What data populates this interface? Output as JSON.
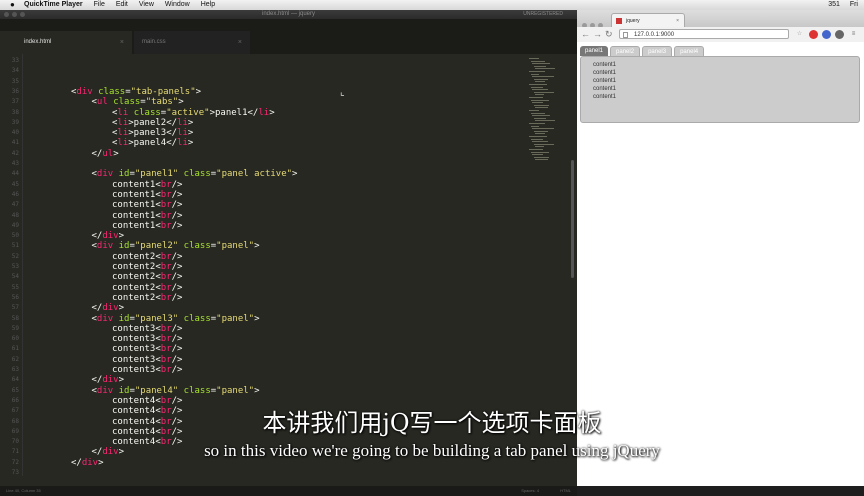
{
  "menubar": {
    "app_name": "QuickTime Player",
    "items": [
      "File",
      "Edit",
      "View",
      "Window",
      "Help"
    ],
    "status": [
      "351",
      "Fri"
    ]
  },
  "editor": {
    "window_title": "index.html — jquery",
    "title_right": "UNREGISTERED",
    "tabs": [
      {
        "label": "index.html",
        "active": true
      },
      {
        "label": "main.css",
        "active": false
      }
    ],
    "line_numbers": [
      "33",
      "34",
      "35",
      "36",
      "37",
      "38",
      "39",
      "40",
      "41",
      "42",
      "43",
      "44",
      "45",
      "46",
      "47",
      "48",
      "49",
      "50",
      "51",
      "52",
      "53",
      "54",
      "55",
      "56",
      "57",
      "58",
      "59",
      "60",
      "61",
      "62",
      "63",
      "64",
      "65",
      "66",
      "67",
      "68",
      "69",
      "70",
      "71",
      "72",
      "73"
    ],
    "code_lines": [
      {
        "indent": 0,
        "parts": []
      },
      {
        "indent": 0,
        "parts": []
      },
      {
        "indent": 0,
        "parts": []
      },
      {
        "indent": 2,
        "parts": [
          [
            "p",
            "<"
          ],
          [
            "t",
            "div"
          ],
          [
            "p",
            " "
          ],
          [
            "a",
            "class"
          ],
          [
            "p",
            "="
          ],
          [
            "s",
            "\"tab-panels\""
          ],
          [
            "p",
            ">"
          ]
        ]
      },
      {
        "indent": 3,
        "parts": [
          [
            "p",
            "<"
          ],
          [
            "t",
            "ul"
          ],
          [
            "p",
            " "
          ],
          [
            "a",
            "class"
          ],
          [
            "p",
            "="
          ],
          [
            "s",
            "\"tabs\""
          ],
          [
            "p",
            ">"
          ]
        ]
      },
      {
        "indent": 4,
        "parts": [
          [
            "p",
            "<"
          ],
          [
            "t",
            "li"
          ],
          [
            "p",
            " "
          ],
          [
            "a",
            "class"
          ],
          [
            "p",
            "="
          ],
          [
            "s",
            "\"active\""
          ],
          [
            "p",
            ">panel1</"
          ],
          [
            "t",
            "li"
          ],
          [
            "p",
            ">"
          ]
        ]
      },
      {
        "indent": 4,
        "parts": [
          [
            "p",
            "<"
          ],
          [
            "t",
            "li"
          ],
          [
            "p",
            ">panel2</"
          ],
          [
            "t",
            "li"
          ],
          [
            "p",
            ">"
          ]
        ]
      },
      {
        "indent": 4,
        "parts": [
          [
            "p",
            "<"
          ],
          [
            "t",
            "li"
          ],
          [
            "p",
            ">panel3</"
          ],
          [
            "t",
            "li"
          ],
          [
            "p",
            ">"
          ]
        ]
      },
      {
        "indent": 4,
        "parts": [
          [
            "p",
            "<"
          ],
          [
            "t",
            "li"
          ],
          [
            "p",
            ">panel4</"
          ],
          [
            "t",
            "li"
          ],
          [
            "p",
            ">"
          ]
        ]
      },
      {
        "indent": 3,
        "parts": [
          [
            "p",
            "</"
          ],
          [
            "t",
            "ul"
          ],
          [
            "p",
            ">"
          ]
        ]
      },
      {
        "indent": 0,
        "parts": []
      },
      {
        "indent": 3,
        "parts": [
          [
            "p",
            "<"
          ],
          [
            "t",
            "div"
          ],
          [
            "p",
            " "
          ],
          [
            "a",
            "id"
          ],
          [
            "p",
            "="
          ],
          [
            "s",
            "\"panel1\""
          ],
          [
            "p",
            " "
          ],
          [
            "a",
            "class"
          ],
          [
            "p",
            "="
          ],
          [
            "s",
            "\"panel active\""
          ],
          [
            "p",
            ">"
          ]
        ]
      },
      {
        "indent": 4,
        "parts": [
          [
            "p",
            "content1<"
          ],
          [
            "t",
            "br"
          ],
          [
            "p",
            "/>"
          ]
        ]
      },
      {
        "indent": 4,
        "parts": [
          [
            "p",
            "content1<"
          ],
          [
            "t",
            "br"
          ],
          [
            "p",
            "/>"
          ]
        ]
      },
      {
        "indent": 4,
        "parts": [
          [
            "p",
            "content1<"
          ],
          [
            "t",
            "br"
          ],
          [
            "p",
            "/>"
          ]
        ]
      },
      {
        "indent": 4,
        "parts": [
          [
            "p",
            "content1<"
          ],
          [
            "t",
            "br"
          ],
          [
            "p",
            "/>"
          ]
        ]
      },
      {
        "indent": 4,
        "parts": [
          [
            "p",
            "content1<"
          ],
          [
            "t",
            "br"
          ],
          [
            "p",
            "/>"
          ]
        ]
      },
      {
        "indent": 3,
        "parts": [
          [
            "p",
            "</"
          ],
          [
            "t",
            "div"
          ],
          [
            "p",
            ">"
          ]
        ]
      },
      {
        "indent": 3,
        "parts": [
          [
            "p",
            "<"
          ],
          [
            "t",
            "div"
          ],
          [
            "p",
            " "
          ],
          [
            "a",
            "id"
          ],
          [
            "p",
            "="
          ],
          [
            "s",
            "\"panel2\""
          ],
          [
            "p",
            " "
          ],
          [
            "a",
            "class"
          ],
          [
            "p",
            "="
          ],
          [
            "s",
            "\"panel\""
          ],
          [
            "p",
            ">"
          ]
        ]
      },
      {
        "indent": 4,
        "parts": [
          [
            "p",
            "content2<"
          ],
          [
            "t",
            "br"
          ],
          [
            "p",
            "/>"
          ]
        ]
      },
      {
        "indent": 4,
        "parts": [
          [
            "p",
            "content2<"
          ],
          [
            "t",
            "br"
          ],
          [
            "p",
            "/>"
          ]
        ]
      },
      {
        "indent": 4,
        "parts": [
          [
            "p",
            "content2<"
          ],
          [
            "t",
            "br"
          ],
          [
            "p",
            "/>"
          ]
        ]
      },
      {
        "indent": 4,
        "parts": [
          [
            "p",
            "content2<"
          ],
          [
            "t",
            "br"
          ],
          [
            "p",
            "/>"
          ]
        ]
      },
      {
        "indent": 4,
        "parts": [
          [
            "p",
            "content2<"
          ],
          [
            "t",
            "br"
          ],
          [
            "p",
            "/>"
          ]
        ]
      },
      {
        "indent": 3,
        "parts": [
          [
            "p",
            "</"
          ],
          [
            "t",
            "div"
          ],
          [
            "p",
            ">"
          ]
        ]
      },
      {
        "indent": 3,
        "parts": [
          [
            "p",
            "<"
          ],
          [
            "t",
            "div"
          ],
          [
            "p",
            " "
          ],
          [
            "a",
            "id"
          ],
          [
            "p",
            "="
          ],
          [
            "s",
            "\"panel3\""
          ],
          [
            "p",
            " "
          ],
          [
            "a",
            "class"
          ],
          [
            "p",
            "="
          ],
          [
            "s",
            "\"panel\""
          ],
          [
            "p",
            ">"
          ]
        ]
      },
      {
        "indent": 4,
        "parts": [
          [
            "p",
            "content3<"
          ],
          [
            "t",
            "br"
          ],
          [
            "p",
            "/>"
          ]
        ]
      },
      {
        "indent": 4,
        "parts": [
          [
            "p",
            "content3<"
          ],
          [
            "t",
            "br"
          ],
          [
            "p",
            "/>"
          ]
        ]
      },
      {
        "indent": 4,
        "parts": [
          [
            "p",
            "content3<"
          ],
          [
            "t",
            "br"
          ],
          [
            "p",
            "/>"
          ]
        ]
      },
      {
        "indent": 4,
        "parts": [
          [
            "p",
            "content3<"
          ],
          [
            "t",
            "br"
          ],
          [
            "p",
            "/>"
          ]
        ]
      },
      {
        "indent": 4,
        "parts": [
          [
            "p",
            "content3<"
          ],
          [
            "t",
            "br"
          ],
          [
            "p",
            "/>"
          ]
        ]
      },
      {
        "indent": 3,
        "parts": [
          [
            "p",
            "</"
          ],
          [
            "t",
            "div"
          ],
          [
            "p",
            ">"
          ]
        ]
      },
      {
        "indent": 3,
        "parts": [
          [
            "p",
            "<"
          ],
          [
            "t",
            "div"
          ],
          [
            "p",
            " "
          ],
          [
            "a",
            "id"
          ],
          [
            "p",
            "="
          ],
          [
            "s",
            "\"panel4\""
          ],
          [
            "p",
            " "
          ],
          [
            "a",
            "class"
          ],
          [
            "p",
            "="
          ],
          [
            "s",
            "\"panel\""
          ],
          [
            "p",
            ">"
          ]
        ]
      },
      {
        "indent": 4,
        "parts": [
          [
            "p",
            "content4<"
          ],
          [
            "t",
            "br"
          ],
          [
            "p",
            "/>"
          ]
        ]
      },
      {
        "indent": 4,
        "parts": [
          [
            "p",
            "content4<"
          ],
          [
            "t",
            "br"
          ],
          [
            "p",
            "/>"
          ]
        ]
      },
      {
        "indent": 4,
        "parts": [
          [
            "p",
            "content4<"
          ],
          [
            "t",
            "br"
          ],
          [
            "p",
            "/>"
          ]
        ]
      },
      {
        "indent": 4,
        "parts": [
          [
            "p",
            "content4<"
          ],
          [
            "t",
            "br"
          ],
          [
            "p",
            "/>"
          ]
        ]
      },
      {
        "indent": 4,
        "parts": [
          [
            "p",
            "content4<"
          ],
          [
            "t",
            "br"
          ],
          [
            "p",
            "/>"
          ]
        ]
      },
      {
        "indent": 3,
        "parts": [
          [
            "p",
            "</"
          ],
          [
            "t",
            "div"
          ],
          [
            "p",
            ">"
          ]
        ]
      },
      {
        "indent": 2,
        "parts": [
          [
            "p",
            "</"
          ],
          [
            "t",
            "div"
          ],
          [
            "p",
            ">"
          ]
        ]
      },
      {
        "indent": 0,
        "parts": []
      }
    ],
    "status_left": "Line 40, Column 35",
    "status_right": [
      "Spaces: 4",
      "HTML"
    ]
  },
  "browser": {
    "tab_title": "jquery",
    "url": "127.0.0.1:9000",
    "page_tabs": [
      {
        "label": "panel1",
        "active": true
      },
      {
        "label": "panel2",
        "active": false
      },
      {
        "label": "panel3",
        "active": false
      },
      {
        "label": "panel4",
        "active": false
      }
    ],
    "panel_lines": [
      "content1",
      "content1",
      "content1",
      "content1",
      "content1"
    ]
  },
  "subtitles": {
    "chinese": "本讲我们用jQ写一个选项卡面板",
    "english": "so in this video we're going to be building a tab panel using jQuery"
  },
  "colors": {
    "tag": "#f92672",
    "attr": "#a6e22e",
    "string": "#e6db74",
    "plain": "#f8f8f2"
  }
}
